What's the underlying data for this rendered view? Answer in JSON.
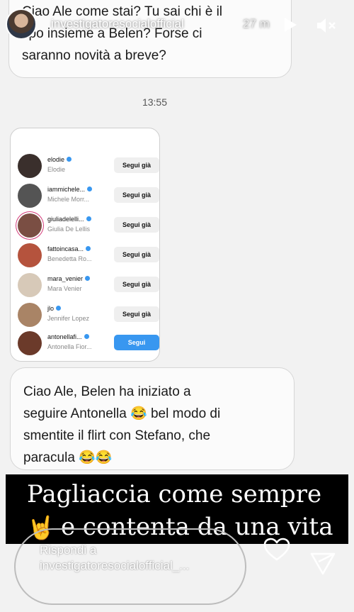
{
  "header": {
    "username": "investigatoresocialofficial",
    "time_ago": "27 m"
  },
  "messages": {
    "top": "Ciao Ale come stai? Tu sai chi è il\ntipo insieme a Belen? Forse ci\nsaranno novità a breve?",
    "timestamp": "13:55",
    "bottom": "Ciao Ale, Belen ha iniziato a\nseguire Antonella 😂 bel modo di\nsmentite il flirt con Stefano, che\nparacula 😂😂"
  },
  "screenshot": {
    "accounts": [
      {
        "handle": "elodie",
        "name": "Elodie",
        "button": "Segui già",
        "avatar_color": "#3a2f2c"
      },
      {
        "handle": "iammichele...",
        "name": "Michele Morr...",
        "button": "Segui già",
        "avatar_color": "#545454"
      },
      {
        "handle": "giuliadelelli...",
        "name": "Giulia De Lellis",
        "button": "Segui già",
        "avatar_color": "#7a4e43"
      },
      {
        "handle": "fattoincasa...",
        "name": "Benedetta Ro...",
        "button": "Segui già",
        "avatar_color": "#b5533d"
      },
      {
        "handle": "mara_venier",
        "name": "Mara Venier",
        "button": "Segui già",
        "avatar_color": "#d7c9b8"
      },
      {
        "handle": "jlo",
        "name": "Jennifer Lopez",
        "button": "Segui già",
        "avatar_color": "#a98466"
      },
      {
        "handle": "antonellafi...",
        "name": "Antonella Fior...",
        "button": "Segui",
        "avatar_color": "#6b3a2a"
      }
    ]
  },
  "caption": {
    "line1": "Pagliaccia come sempre",
    "line2": "e contenta da una vita",
    "emoji": "🤘"
  },
  "reply": {
    "placeholder": "Rispondi a investigatoresocialofficial_..."
  },
  "colors": {
    "follow_primary": "#3897f0",
    "verified": "#3897f0"
  }
}
